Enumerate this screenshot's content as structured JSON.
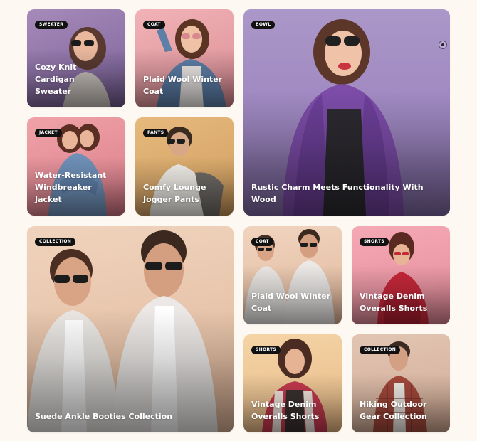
{
  "cards": [
    {
      "tag": "SWEATER",
      "title_line1": "Cozy Knit Cardigan",
      "title_line2": "Sweater"
    },
    {
      "tag": "COAT",
      "title_line1": "Plaid Wool Winter",
      "title_line2": "Coat"
    },
    {
      "tag": "BOWL",
      "title_line1": "Rustic Charm Meets Functionality With Wood",
      "title_line2": ""
    },
    {
      "tag": "JACKET",
      "title_line1": "Water-Resistant",
      "title_line2": "Windbreaker Jacket"
    },
    {
      "tag": "PANTS",
      "title_line1": "Comfy Lounge",
      "title_line2": "Jogger Pants"
    },
    {
      "tag": "COLLECTION",
      "title_line1": "Suede Ankle Booties Collection",
      "title_line2": ""
    },
    {
      "tag": "COAT",
      "title_line1": "Plaid Wool Winter",
      "title_line2": "Coat"
    },
    {
      "tag": "SHORTS",
      "title_line1": "Vintage Denim",
      "title_line2": "Overalls Shorts"
    },
    {
      "tag": "SHORTS",
      "title_line1": "Vintage Denim",
      "title_line2": "Overalls Shorts"
    },
    {
      "tag": "COLLECTION",
      "title_line1": "Hiking Outdoor",
      "title_line2": "Gear Collection"
    }
  ],
  "colors": {
    "page_bg": "#fdf8f2",
    "tag_bg": "#111111",
    "tag_text": "#ffffff",
    "title_text": "#ffffff"
  },
  "icons": {
    "slider_indicator": "radio-dot-icon"
  }
}
